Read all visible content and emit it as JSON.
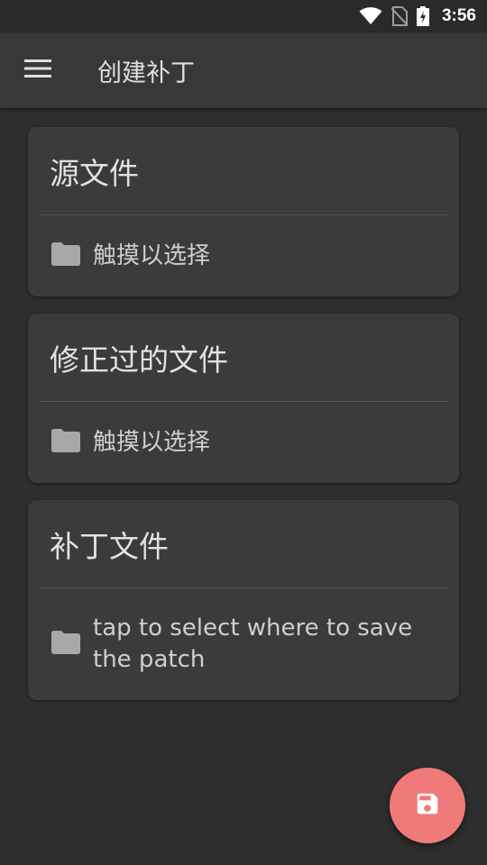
{
  "status": {
    "time": "3:56",
    "icons": [
      "wifi-icon",
      "no-sim-icon",
      "battery-charging-icon"
    ]
  },
  "app_bar": {
    "menu_icon": "hamburger-menu-icon",
    "title": "创建补丁"
  },
  "cards": [
    {
      "title": "源文件",
      "icon": "folder-icon",
      "text": "触摸以选择"
    },
    {
      "title": "修正过的文件",
      "icon": "folder-icon",
      "text": "触摸以选择"
    },
    {
      "title": "补丁文件",
      "icon": "folder-icon",
      "text": "tap to select where to save the patch"
    }
  ],
  "fab": {
    "icon": "save-icon",
    "color": "#f07a7a"
  },
  "colors": {
    "background": "#2e2e2e",
    "app_bar": "#383838",
    "card": "#3b3b3b",
    "fab": "#f07a7a"
  }
}
